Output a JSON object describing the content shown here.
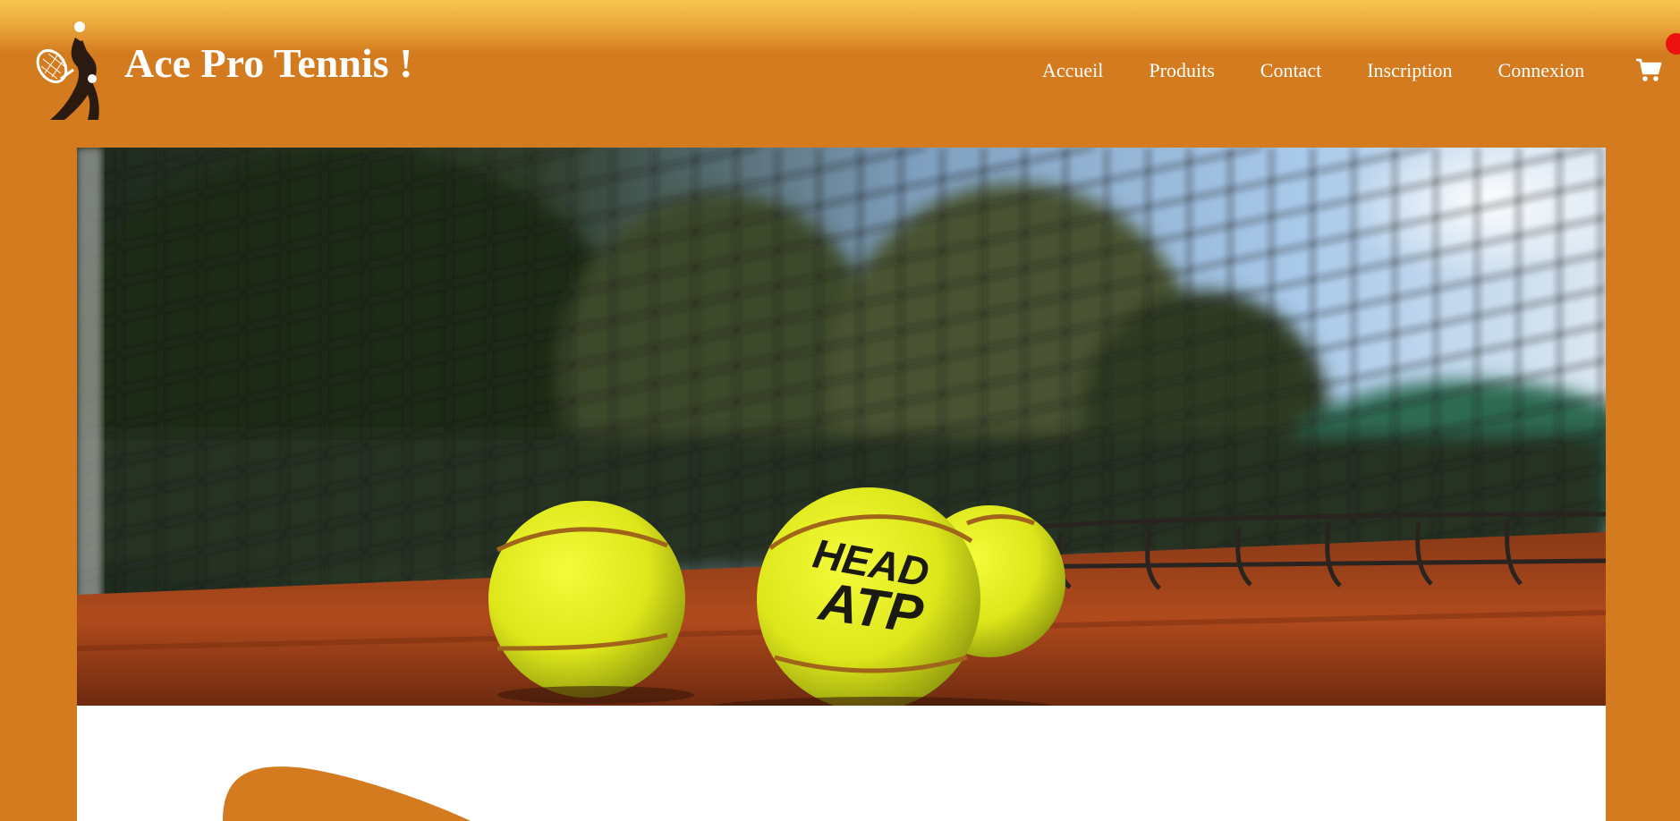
{
  "header": {
    "site_title": "Ace Pro Tennis !",
    "logo_icon": "tennis-player-serve-icon"
  },
  "nav": {
    "items": [
      {
        "label": "Accueil"
      },
      {
        "label": "Produits"
      },
      {
        "label": "Contact"
      },
      {
        "label": "Inscription"
      },
      {
        "label": "Connexion"
      }
    ],
    "cart_icon": "shopping-cart-icon"
  },
  "hero": {
    "ball_brand": "HEAD",
    "ball_text": "ATP"
  },
  "colors": {
    "brand_orange": "#d37b1e",
    "header_top_yellow": "#f6c64e",
    "badge_red": "#ee1111",
    "ball_yellow": "#e4ec1a",
    "clay": "#b04a1c"
  }
}
